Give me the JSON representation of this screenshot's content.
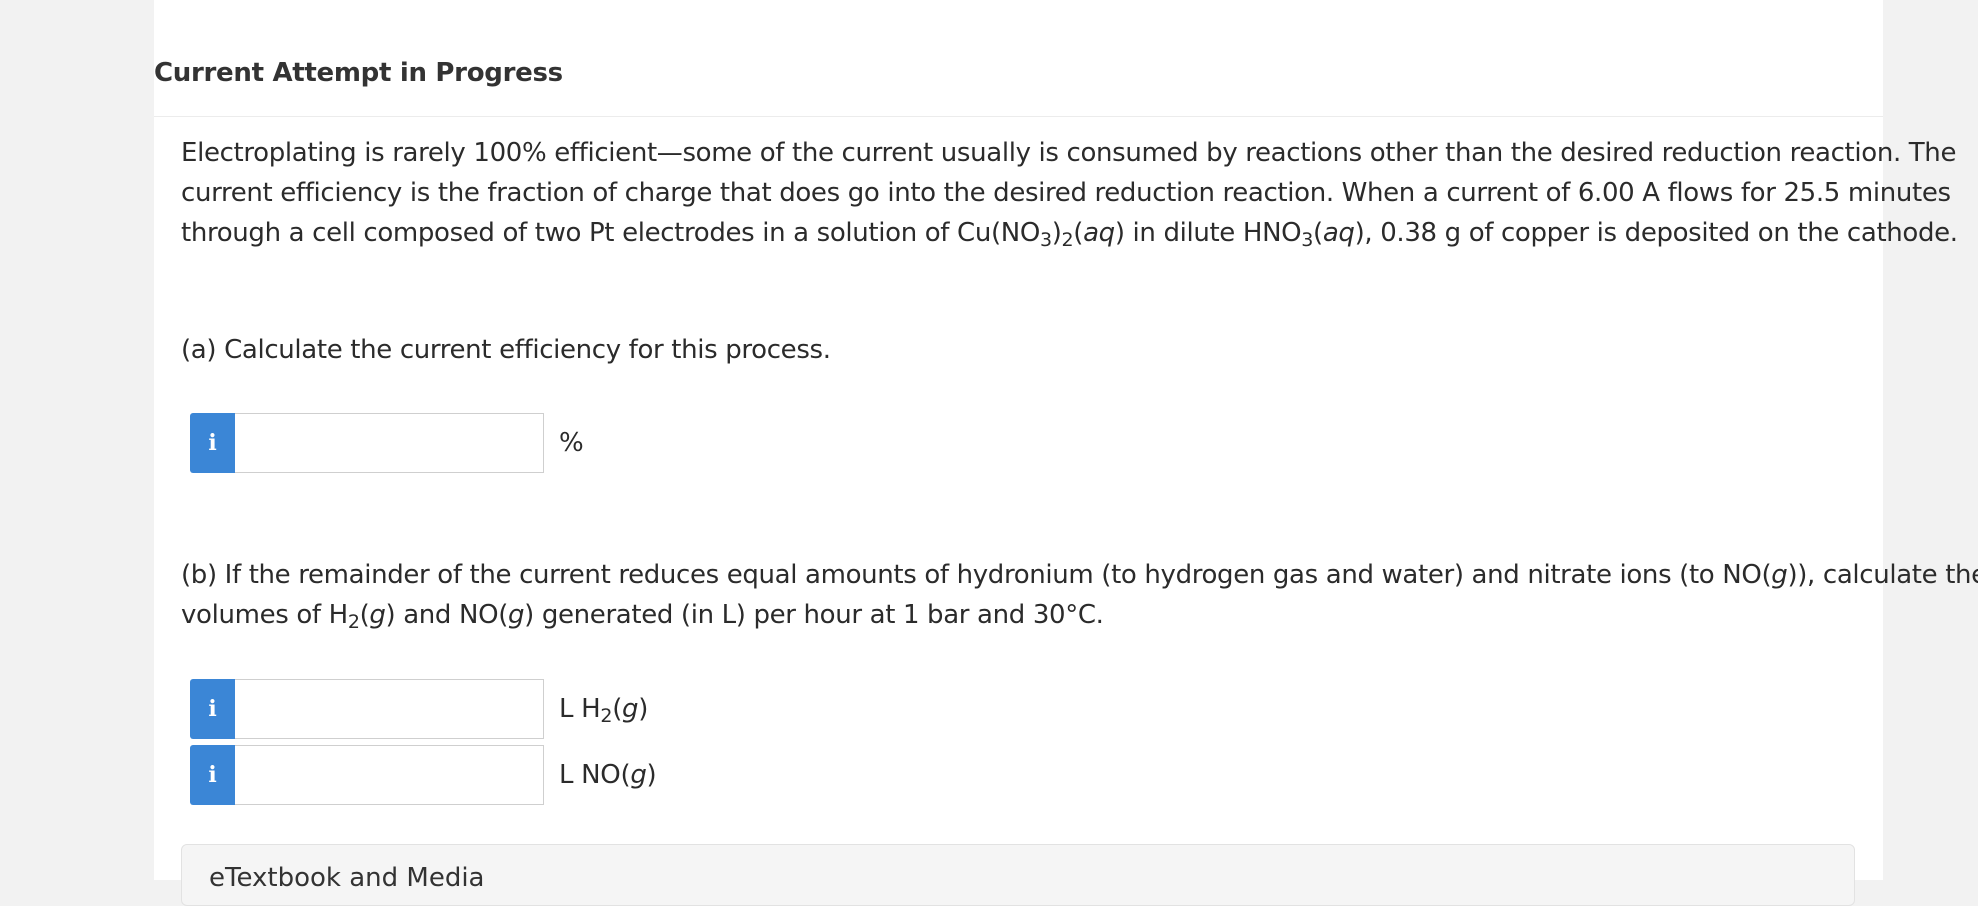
{
  "header": {
    "title": "Current Attempt in Progress"
  },
  "question": {
    "intro": {
      "p1": "Electroplating is rarely 100% efficient—some of the current usually is consumed by reactions other than the desired reduction reaction. The current efficiency is the fraction of charge that does go into the desired reduction reaction. When a current of 6.00 A flows for 25.5 minutes through a cell composed of two Pt electrodes in a solution of Cu(NO",
      "sub1": "3",
      "p2": ")",
      "sub2": "2",
      "p3": "(",
      "italic1": "aq",
      "p4": ") in dilute HNO",
      "sub3": "3",
      "p5": "(",
      "italic2": "aq",
      "p6": "), 0.38 g of copper is deposited on the cathode."
    },
    "part_a": {
      "text": "(a) Calculate the current efficiency for this process.",
      "input_value": "",
      "unit": "%"
    },
    "part_b": {
      "p1": "(b) If the remainder of the current reduces equal amounts of hydronium (to hydrogen gas and water) and nitrate ions (to NO(",
      "italic1": "g",
      "p2": ")), calculate the volumes of H",
      "sub1": "2",
      "p3": "(",
      "italic2": "g",
      "p4": ") and NO(",
      "italic3": "g",
      "p5": ") generated (in L) per hour at 1 bar and 30°C.",
      "input1_value": "",
      "unit1": {
        "pre": "L H",
        "sub": "2",
        "open": "(",
        "italic": "g",
        "close": ")"
      },
      "input2_value": "",
      "unit2": {
        "pre": "L NO(",
        "italic": "g",
        "close": ")"
      }
    }
  },
  "info_button": {
    "label": "i",
    "color": "#3b86d6"
  },
  "etextbook": {
    "label": "eTextbook and Media"
  }
}
